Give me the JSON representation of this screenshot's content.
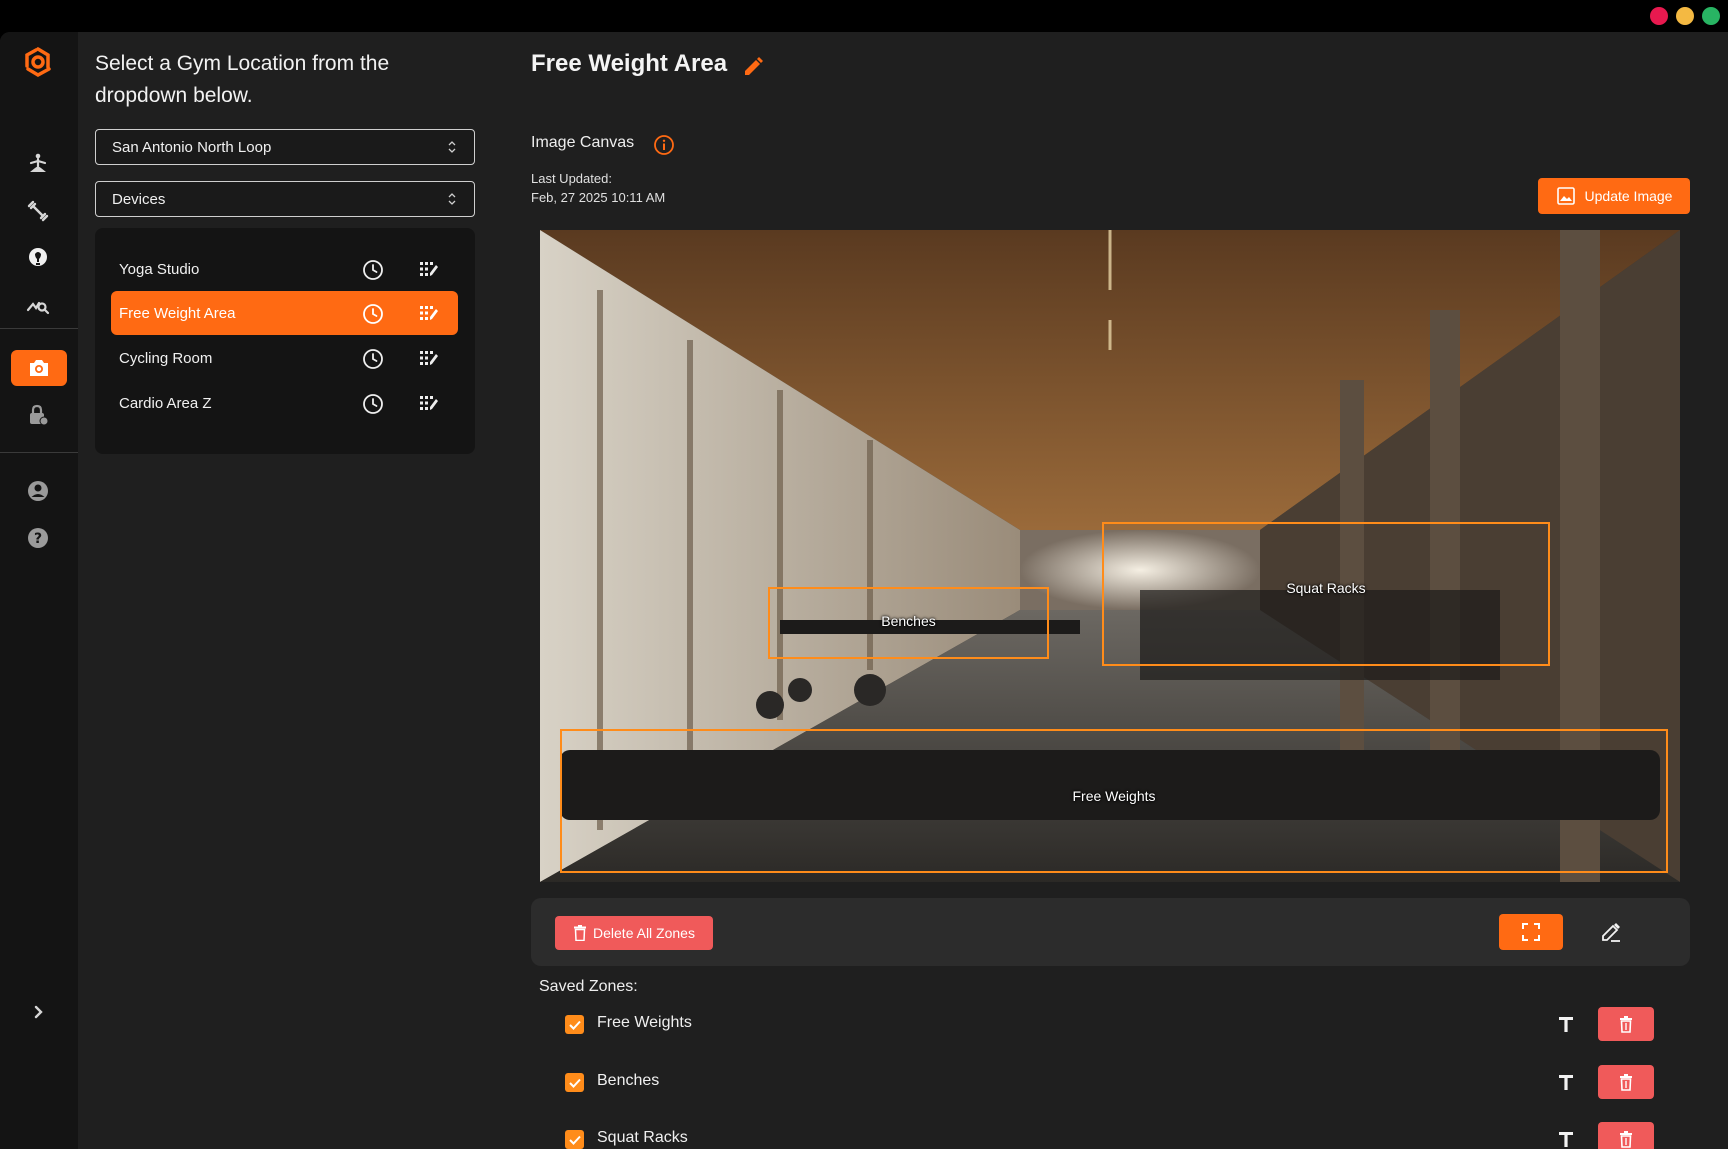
{
  "window": {
    "controls": [
      "close",
      "minimize",
      "maximize"
    ]
  },
  "rail": {
    "icons": [
      "logo-icon",
      "yoga-icon",
      "dumbbell-icon",
      "lightbulb-icon",
      "analytics-icon",
      "camera-icon",
      "lock-icon",
      "account-icon",
      "help-icon",
      "chevron-right-icon"
    ],
    "active": "camera-icon"
  },
  "panel": {
    "heading": "Select a Gym Location from the dropdown below.",
    "location_select": "San Antonio North Loop",
    "type_select": "Devices",
    "devices": [
      {
        "label": "Yoga Studio",
        "active": false
      },
      {
        "label": "Free Weight Area",
        "active": true
      },
      {
        "label": "Cycling Room",
        "active": false
      },
      {
        "label": "Cardio Area Z",
        "active": false
      }
    ]
  },
  "main": {
    "title": "Free Weight Area",
    "canvas_label": "Image Canvas",
    "last_updated_label": "Last Updated:",
    "last_updated_value": "Feb, 27 2025 10:11 AM",
    "update_button": "Update Image",
    "canvas_zones": [
      {
        "label": "Benches"
      },
      {
        "label": "Squat Racks"
      },
      {
        "label": "Free Weights"
      }
    ],
    "delete_all_button": "Delete All Zones",
    "saved_zones_title": "Saved Zones:",
    "saved_zones": [
      {
        "label": "Free Weights",
        "checked": true
      },
      {
        "label": "Benches",
        "checked": true
      },
      {
        "label": "Squat Racks",
        "checked": true
      }
    ]
  },
  "colors": {
    "accent": "#ff6a13",
    "danger": "#f05a5a",
    "zone_outline": "#ff8c1a"
  }
}
